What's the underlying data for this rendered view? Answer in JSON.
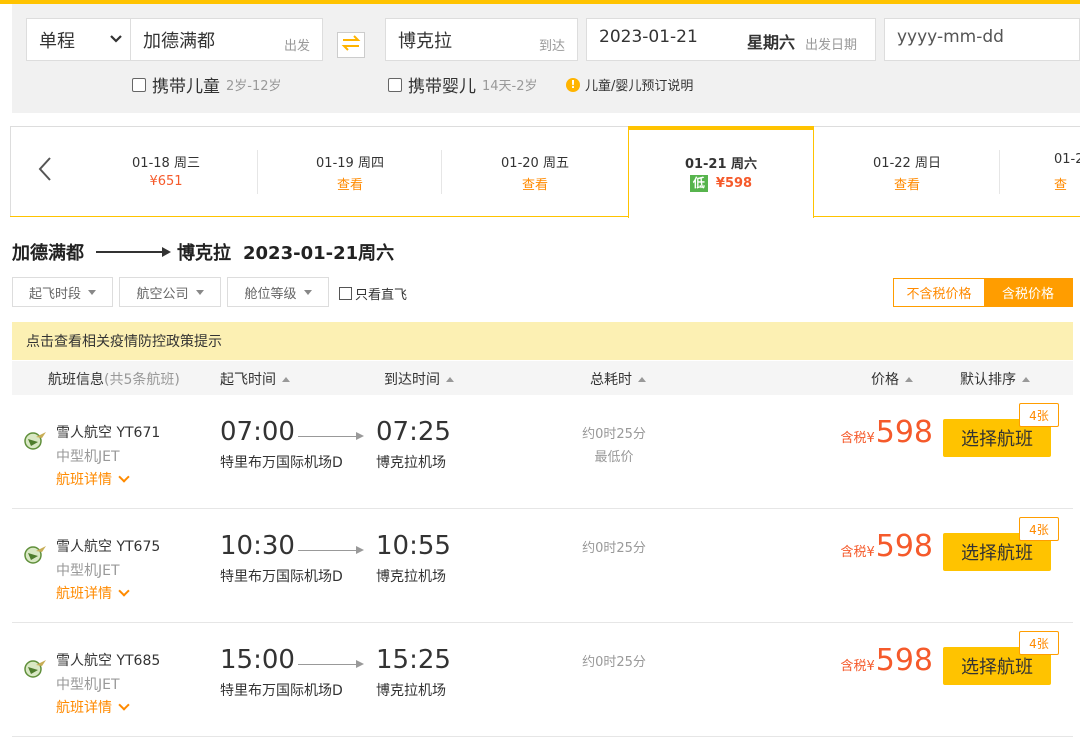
{
  "search": {
    "trip_type": "单程",
    "from_city": "加德满都",
    "from_hint": "出发",
    "to_city": "博克拉",
    "to_hint": "到达",
    "depart_date": "2023-01-21",
    "depart_weekday": "星期六",
    "depart_hint": "出发日期",
    "return_placeholder": "yyyy-mm-dd",
    "child_label": "携带儿童",
    "child_age": "2岁-12岁",
    "infant_label": "携带婴儿",
    "infant_age": "14天-2岁",
    "booking_note": "儿童/婴儿预订说明",
    "note_icon_glyph": "!"
  },
  "dates": [
    {
      "date": "01-18 周三",
      "price": "¥651",
      "type": "price"
    },
    {
      "date": "01-19 周四",
      "price": "查看",
      "type": "view"
    },
    {
      "date": "01-20 周五",
      "price": "查看",
      "type": "view"
    },
    {
      "date": "01-21 周六",
      "price": "¥598",
      "type": "active",
      "tag": "低"
    },
    {
      "date": "01-22 周日",
      "price": "查看",
      "type": "view"
    },
    {
      "date": "01-2",
      "price": "查",
      "type": "view"
    }
  ],
  "route": {
    "from": "加德满都",
    "to": "博克拉",
    "date": "2023-01-21周六"
  },
  "filters": {
    "time": "起飞时段",
    "airline": "航空公司",
    "cabin": "舱位等级",
    "direct": "只看直飞"
  },
  "tax_switch": {
    "excl": "不含税价格",
    "incl": "含税价格"
  },
  "notice": "点击查看相关疫情防控政策提示",
  "table_head": {
    "info": "航班信息",
    "count": "(共5条航班)",
    "dep": "起飞时间",
    "arr": "到达时间",
    "duration": "总耗时",
    "price": "价格",
    "sort": "默认排序"
  },
  "flights": [
    {
      "airline": "雪人航空 YT671",
      "plane": "中型机JET",
      "detail": "航班详情",
      "dep_time": "07:00",
      "arr_time": "07:25",
      "dep_airport": "特里布万国际机场D",
      "arr_airport": "博克拉机场",
      "duration": "约0时25分",
      "lowest": "最低价",
      "tax_label": "含税",
      "currency": "¥",
      "price": "598",
      "seats": "4张",
      "select": "选择航班"
    },
    {
      "airline": "雪人航空 YT675",
      "plane": "中型机JET",
      "detail": "航班详情",
      "dep_time": "10:30",
      "arr_time": "10:55",
      "dep_airport": "特里布万国际机场D",
      "arr_airport": "博克拉机场",
      "duration": "约0时25分",
      "tax_label": "含税",
      "currency": "¥",
      "price": "598",
      "seats": "4张",
      "select": "选择航班"
    },
    {
      "airline": "雪人航空 YT685",
      "plane": "中型机JET",
      "detail": "航班详情",
      "dep_time": "15:00",
      "arr_time": "15:25",
      "dep_airport": "特里布万国际机场D",
      "arr_airport": "博克拉机场",
      "duration": "约0时25分",
      "tax_label": "含税",
      "currency": "¥",
      "price": "598",
      "seats": "4张",
      "select": "选择航班"
    }
  ],
  "colors": {
    "accent": "#ffc300",
    "price": "#f55a2b",
    "link": "#ff8a00",
    "low_tag": "#57b44d"
  },
  "icons": {
    "trip_select": "chevron-down-icon",
    "swap": "swap-arrows-icon",
    "prev": "chevron-left-icon",
    "info": "info-icon",
    "airline": "airline-logo-icon"
  }
}
